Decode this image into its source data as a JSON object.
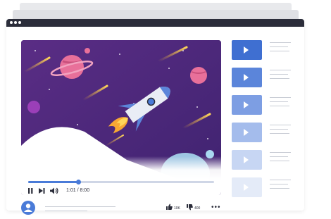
{
  "player": {
    "time_label": "1:01 / 8:00",
    "progress": 0.27
  },
  "reactions": {
    "likes": "10K",
    "dislikes": "400"
  },
  "sidebar": {
    "thumbnails": [
      {
        "color": "#3f6fd1"
      },
      {
        "color": "#5b85da"
      },
      {
        "color": "#7d9ee3"
      },
      {
        "color": "#a4bcec"
      },
      {
        "color": "#c7d6f3"
      },
      {
        "color": "#e4ebf8"
      }
    ]
  },
  "colors": {
    "titlebar": "#2b2d3a",
    "accent": "#4a7bd8",
    "scene_background": "#4e2a78"
  },
  "icons": [
    "play-icon",
    "pause-icon",
    "skip-next-icon",
    "volume-icon",
    "avatar-icon",
    "thumbs-up-icon",
    "thumbs-down-icon",
    "more-icon",
    "rocket-illustration"
  ]
}
